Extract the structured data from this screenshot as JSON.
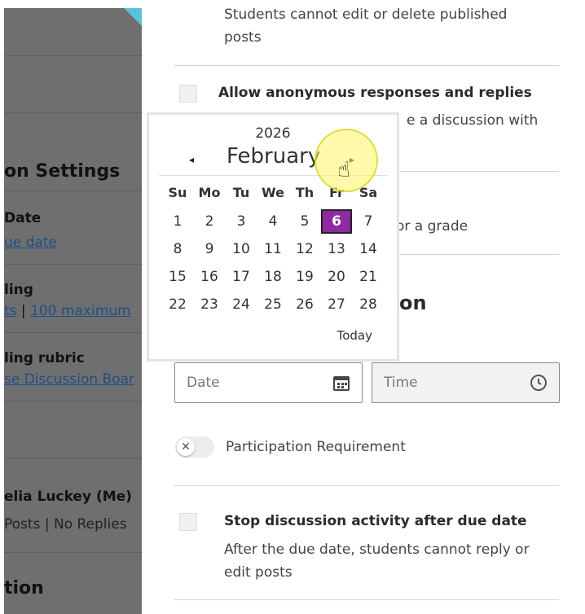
{
  "left": {
    "settings_title": "on Settings",
    "due_date_label": "Date",
    "due_date_link": "ue date",
    "grading_label": "ling",
    "grading_links_a": "ts",
    "grading_sep": " | ",
    "grading_links_b": "100 maximum",
    "rubric_label": "ling rubric",
    "rubric_link": "se Discussion Boar",
    "participant_name": "elia Luckey (Me)",
    "participant_posts": "Posts",
    "participant_sep": " | ",
    "participant_replies": "No Replies",
    "section_bottom": "tion"
  },
  "right": {
    "top_text_1": "Students cannot edit or delete published",
    "top_text_2": "posts",
    "anon_title": "Allow anonymous responses and replies",
    "anon_desc_tail": "e a discussion with",
    "grade_fragment": "or a grade",
    "section_fragment": "on",
    "date_placeholder": "Date",
    "time_placeholder": "Time",
    "participation_label": "Participation Requirement",
    "stop_title": "Stop discussion activity after due date",
    "stop_desc_1": "After the due date, students cannot reply or",
    "stop_desc_2": "edit posts"
  },
  "calendar": {
    "year": "2026",
    "month": "February",
    "prev_glyph": "◂",
    "next_glyph": "▸",
    "weekdays": [
      "Su",
      "Mo",
      "Tu",
      "We",
      "Th",
      "Fr",
      "Sa"
    ],
    "weeks": [
      [
        "1",
        "2",
        "3",
        "4",
        "5",
        "6",
        "7"
      ],
      [
        "8",
        "9",
        "10",
        "11",
        "12",
        "13",
        "14"
      ],
      [
        "15",
        "16",
        "17",
        "18",
        "19",
        "20",
        "21"
      ],
      [
        "22",
        "23",
        "24",
        "25",
        "26",
        "27",
        "28"
      ]
    ],
    "selected_day": "6",
    "today_label": "Today",
    "accent": "#8e2aa3"
  },
  "icons": {
    "calendar": "calendar-icon",
    "clock": "clock-icon",
    "toggle_x": "✕",
    "cursor": "hand-pointer-icon"
  }
}
